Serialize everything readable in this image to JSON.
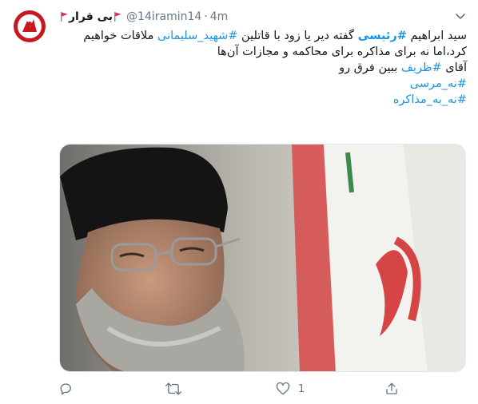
{
  "tweet": {
    "display_name": "بی قرار",
    "handle": "@14iramin14",
    "separator": "·",
    "time": "4m",
    "avatar_icon": "profile-logo-icon",
    "flag_icon": "red-flag-icon",
    "caret_icon": "chevron-down-icon",
    "text": {
      "l1_a": "سید ابراهیم ",
      "l1_tag": "#رئیسی",
      "l1_b": " گفته دیر یا زود با قاتلین ",
      "l1_tag2": "#شهید_سلیمانی",
      "l1_c": " ملاقات خواهیم",
      "l2": "کرد،اما نه برای مذاکره برای محاکمه و مجازات آن‌ها",
      "l3_a": "آقای ",
      "l3_tag": "#ظریف",
      "l3_b": " ببین فرق رو",
      "l4_tag": "#نه_مرسی",
      "l5_tag": "#نه_به_مذاکره"
    },
    "photo_icon": "tweet-photo",
    "actions": {
      "reply_icon": "reply-icon",
      "retweet_icon": "retweet-icon",
      "like_icon": "heart-icon",
      "like_count": "1",
      "share_icon": "share-icon"
    },
    "colors": {
      "link": "#1b95e0",
      "muted": "#657786",
      "flag": "#e0245e"
    }
  }
}
